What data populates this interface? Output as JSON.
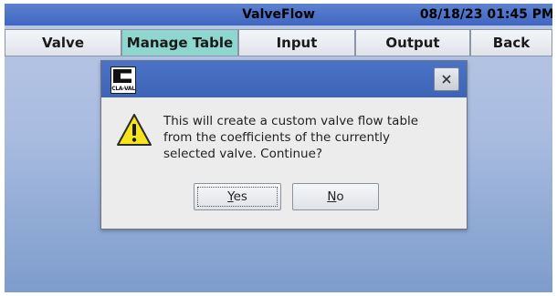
{
  "window": {
    "title": "ValveFlow",
    "datetime": "08/18/23 01:45 PM"
  },
  "menu": {
    "items": [
      {
        "label": "Valve"
      },
      {
        "label": "Manage Table",
        "active": true
      },
      {
        "label": "Input"
      },
      {
        "label": "Output"
      },
      {
        "label": "Back"
      }
    ]
  },
  "dialog": {
    "logo_text": "CLA-VAL",
    "close_icon": "×",
    "icon": "warning-icon",
    "message_lines": [
      "This will create a custom valve flow table",
      "from the coefficients of the currently",
      "selected valve. Continue?"
    ],
    "yes_mnemonic": "Y",
    "yes_rest": "es",
    "no_mnemonic": "N",
    "no_rest": "o"
  },
  "colors": {
    "titlebar": "#4a70c8",
    "active_menu": "#8fd6cf",
    "dialog_titlebar": "#4a72c6",
    "warning": "#f6e41c"
  }
}
